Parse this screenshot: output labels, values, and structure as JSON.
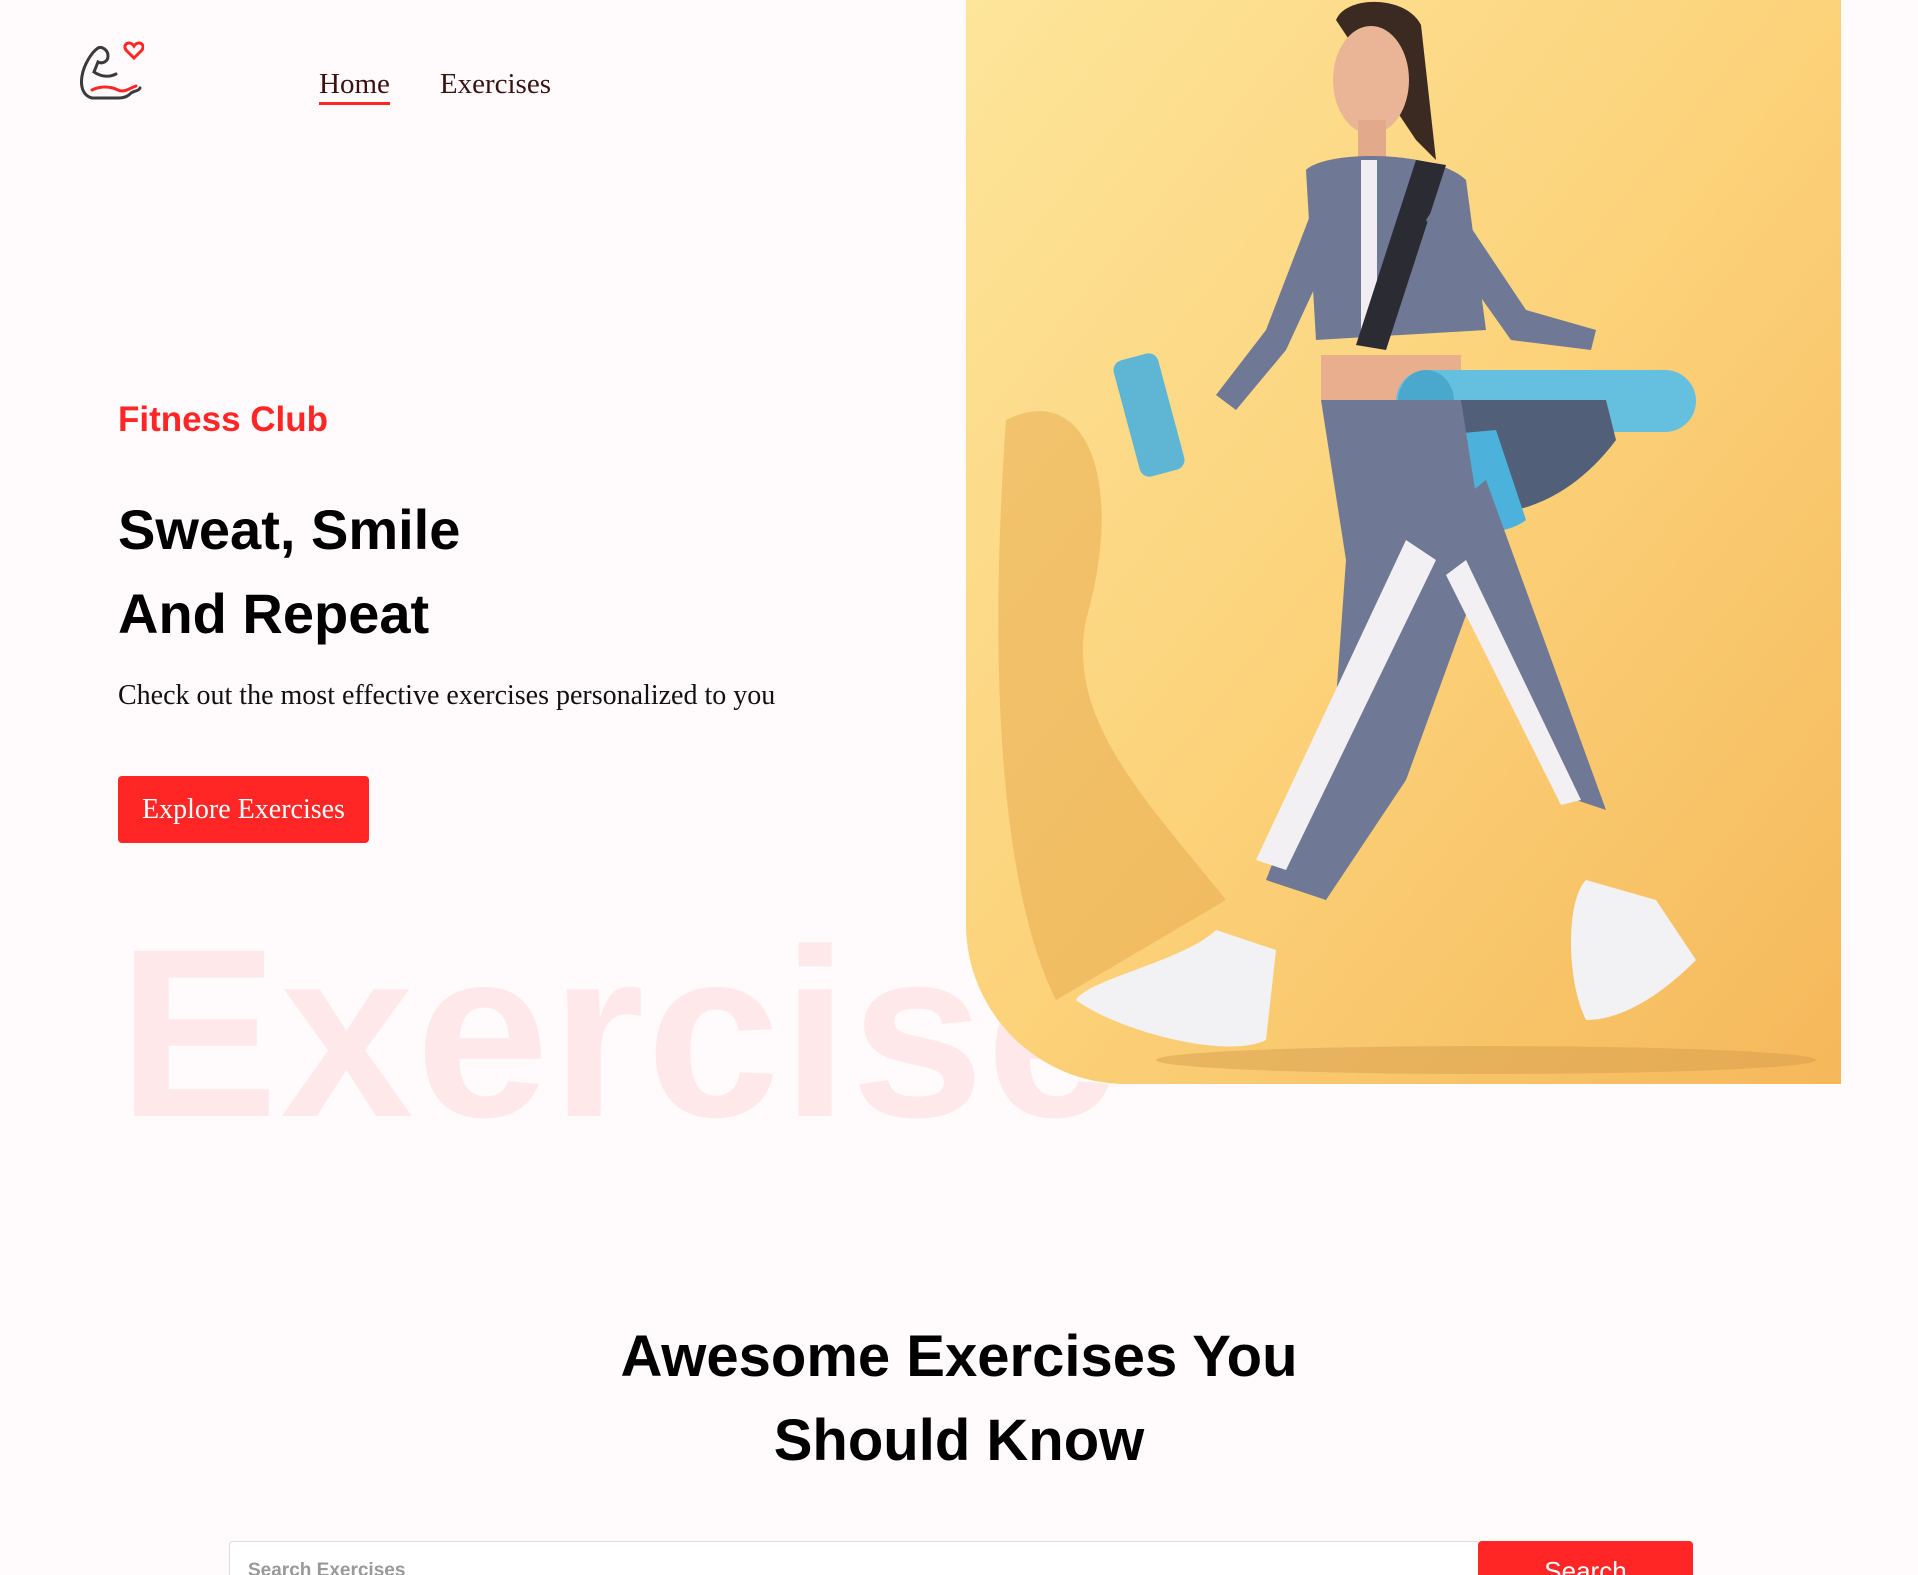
{
  "nav": {
    "logo_icon": "flexed-arm-heart-icon",
    "items": [
      {
        "label": "Home",
        "active": true
      },
      {
        "label": "Exercises",
        "active": false
      }
    ]
  },
  "hero": {
    "eyebrow": "Fitness Club",
    "title_line1": "Sweat, Smile",
    "title_line2": "And Repeat",
    "subtitle": "Check out the most effective exercises personalized to you",
    "cta_label": "Explore Exercises",
    "watermark": "Exercise",
    "image_alt": "woman in athletic wear walking with water bottle and gym bag"
  },
  "section": {
    "title_line1": "Awesome Exercises You",
    "title_line2": "Should Know"
  },
  "search": {
    "placeholder": "Search Exercises",
    "value": "",
    "button_label": "Search"
  },
  "colors": {
    "accent": "#ff2625",
    "background": "#fffafb",
    "hero_bg": "#fcd983"
  }
}
